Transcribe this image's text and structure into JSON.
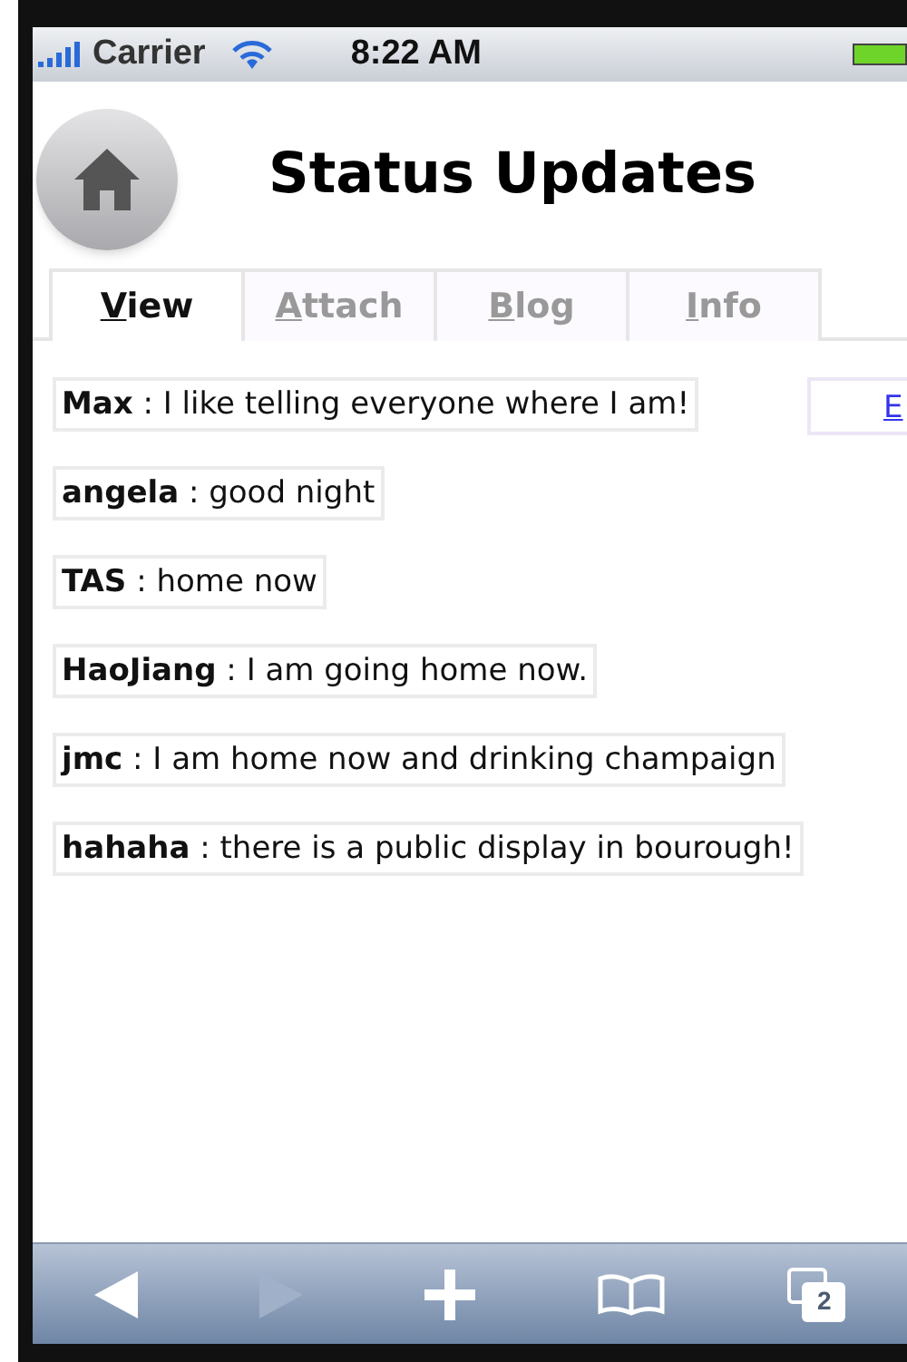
{
  "status_bar": {
    "carrier": "Carrier",
    "time": "8:22 AM"
  },
  "header": {
    "title": "Status Updates"
  },
  "tabs": [
    {
      "label": "View",
      "selected": true
    },
    {
      "label": "Attach",
      "selected": false
    },
    {
      "label": "Blog",
      "selected": false
    },
    {
      "label": "Info",
      "selected": false
    }
  ],
  "updates": [
    {
      "text": "**Max** : I like telling everyone where I am!"
    },
    {
      "text": "**angela** : good night"
    },
    {
      "text": "**TAS** : home now"
    },
    {
      "text": "**HaoJiang** : I am going home now."
    },
    {
      "text": "**jmc** : I am home now and drinking champaign"
    },
    {
      "text": "**hahaha** : there is a public display in bourough!"
    }
  ],
  "side_link": "E",
  "toolbar": {
    "back_disabled": false,
    "forward_disabled": true,
    "tab_count": "2"
  }
}
